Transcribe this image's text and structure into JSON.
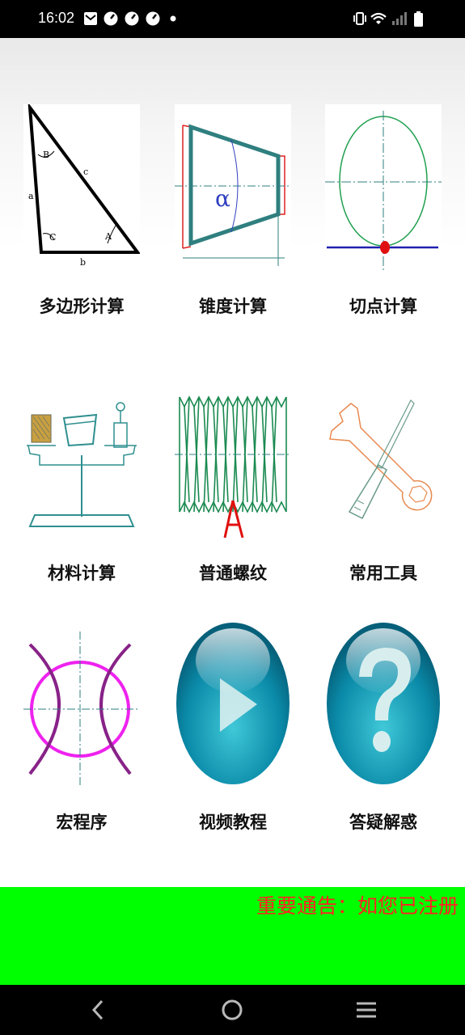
{
  "status_bar": {
    "time": "16:02"
  },
  "grid": {
    "items": [
      {
        "label": "多边形计算",
        "icon": "triangle-diagram-icon"
      },
      {
        "label": "锥度计算",
        "icon": "taper-diagram-icon"
      },
      {
        "label": "切点计算",
        "icon": "tangent-point-diagram-icon"
      },
      {
        "label": "材料计算",
        "icon": "material-shapes-icon"
      },
      {
        "label": "普通螺纹",
        "icon": "thread-diagram-icon"
      },
      {
        "label": "常用工具",
        "icon": "wrench-screwdriver-icon"
      },
      {
        "label": "宏程序",
        "icon": "macro-circle-arcs-icon"
      },
      {
        "label": "视频教程",
        "icon": "play-button-icon"
      },
      {
        "label": "答疑解惑",
        "icon": "question-mark-icon"
      }
    ]
  },
  "banner": {
    "text": "重要通告：如您已注册"
  },
  "colors": {
    "banner_bg": "#00ff00",
    "banner_text": "#ff2222",
    "status_bar": "#000000"
  }
}
